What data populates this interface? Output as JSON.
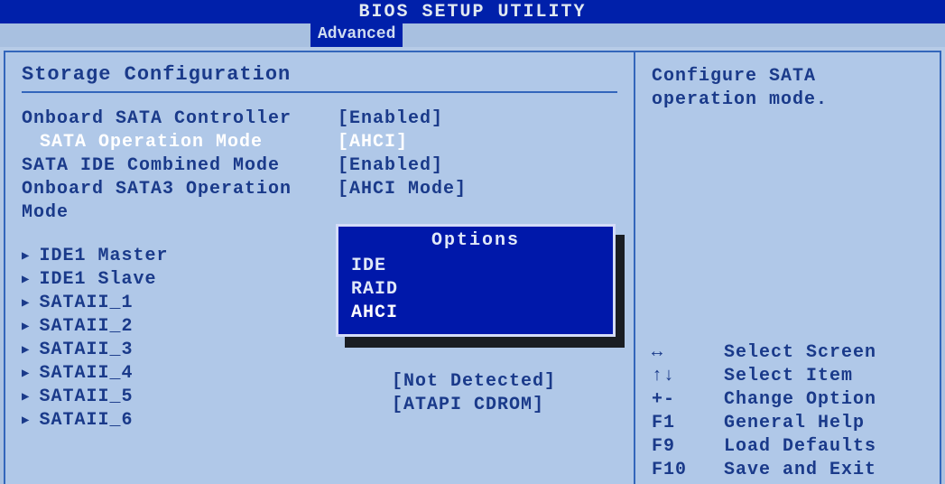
{
  "title": "BIOS SETUP UTILITY",
  "tab": "Advanced",
  "left": {
    "section_title": "Storage Configuration",
    "settings": [
      {
        "label": "Onboard SATA Controller",
        "value": "[Enabled]",
        "selected": false
      },
      {
        "label": "SATA Operation Mode",
        "value": "[AHCI]",
        "selected": true
      },
      {
        "label": "SATA IDE Combined Mode",
        "value": "[Enabled]",
        "selected": false
      },
      {
        "label": "Onboard SATA3 Operation Mode",
        "value": "[AHCI Mode]",
        "selected": false
      }
    ],
    "devices": [
      {
        "label": "IDE1 Master"
      },
      {
        "label": "IDE1 Slave"
      },
      {
        "label": "SATAII_1"
      },
      {
        "label": "SATAII_2"
      },
      {
        "label": "SATAII_3"
      },
      {
        "label": "SATAII_4"
      },
      {
        "label": "SATAII_5"
      },
      {
        "label": "SATAII_6"
      }
    ],
    "below_popup": [
      "[Not Detected]",
      "[ATAPI CDROM]"
    ],
    "popup": {
      "title": "Options",
      "items": [
        {
          "label": "IDE",
          "selected": false
        },
        {
          "label": "RAID",
          "selected": false
        },
        {
          "label": "AHCI",
          "selected": true
        }
      ]
    }
  },
  "right": {
    "help_line1": "Configure SATA",
    "help_line2": "operation mode.",
    "keys": [
      {
        "sym": "↔",
        "desc": "Select Screen"
      },
      {
        "sym": "↑↓",
        "desc": "Select Item"
      },
      {
        "sym": "+-",
        "desc": "Change Option"
      },
      {
        "sym": "F1",
        "desc": "General Help"
      },
      {
        "sym": "F9",
        "desc": "Load Defaults"
      },
      {
        "sym": "F10",
        "desc": "Save and Exit"
      }
    ]
  }
}
